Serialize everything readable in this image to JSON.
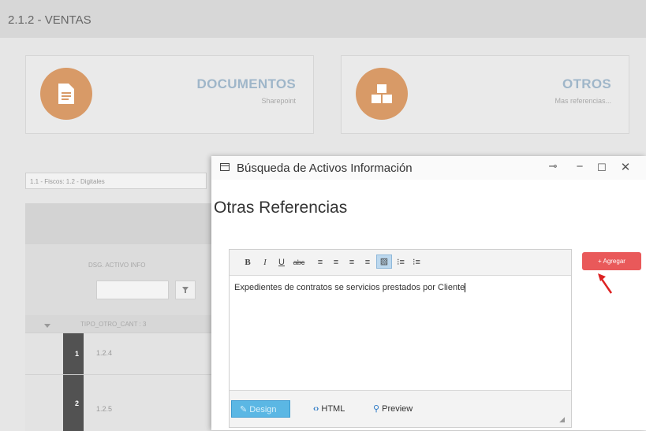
{
  "header": {
    "title": "2.1.2 - VENTAS"
  },
  "tiles": [
    {
      "title": "DOCUMENTOS",
      "subtitle": "Sharepoint",
      "icon": "document-icon"
    },
    {
      "title": "OTROS",
      "subtitle": "Mas referencias...",
      "icon": "boxes-icon"
    }
  ],
  "filter": {
    "select_value": "1.1 - Fiscos: 1.2 - Digitales"
  },
  "grid": {
    "column_header": "DSG. ACTIVO INFO",
    "group_label": "TIPO_OTRO_CANT : 3",
    "rows": [
      {
        "num": "1",
        "code": "1.2.4"
      },
      {
        "num": "2",
        "code": "1.2.5"
      }
    ]
  },
  "modal": {
    "title": "Búsqueda de Activos Información",
    "heading": "Otras Referencias",
    "editor": {
      "toolbar": [
        "B",
        "I",
        "U",
        "abc",
        "align-left",
        "align-center",
        "align-right",
        "justify",
        "clear-format",
        "ordered-list",
        "unordered-list"
      ],
      "content": "Expedientes de contratos se servicios prestados por Cliente",
      "modes": {
        "design": "Design",
        "html": "HTML",
        "preview": "Preview"
      }
    },
    "add_button": "Agregar"
  },
  "colors": {
    "accent_orange": "#d89a67",
    "tile_title": "#9fb6c9",
    "add_red": "#e9595a",
    "design_blue": "#5bb7e4"
  }
}
